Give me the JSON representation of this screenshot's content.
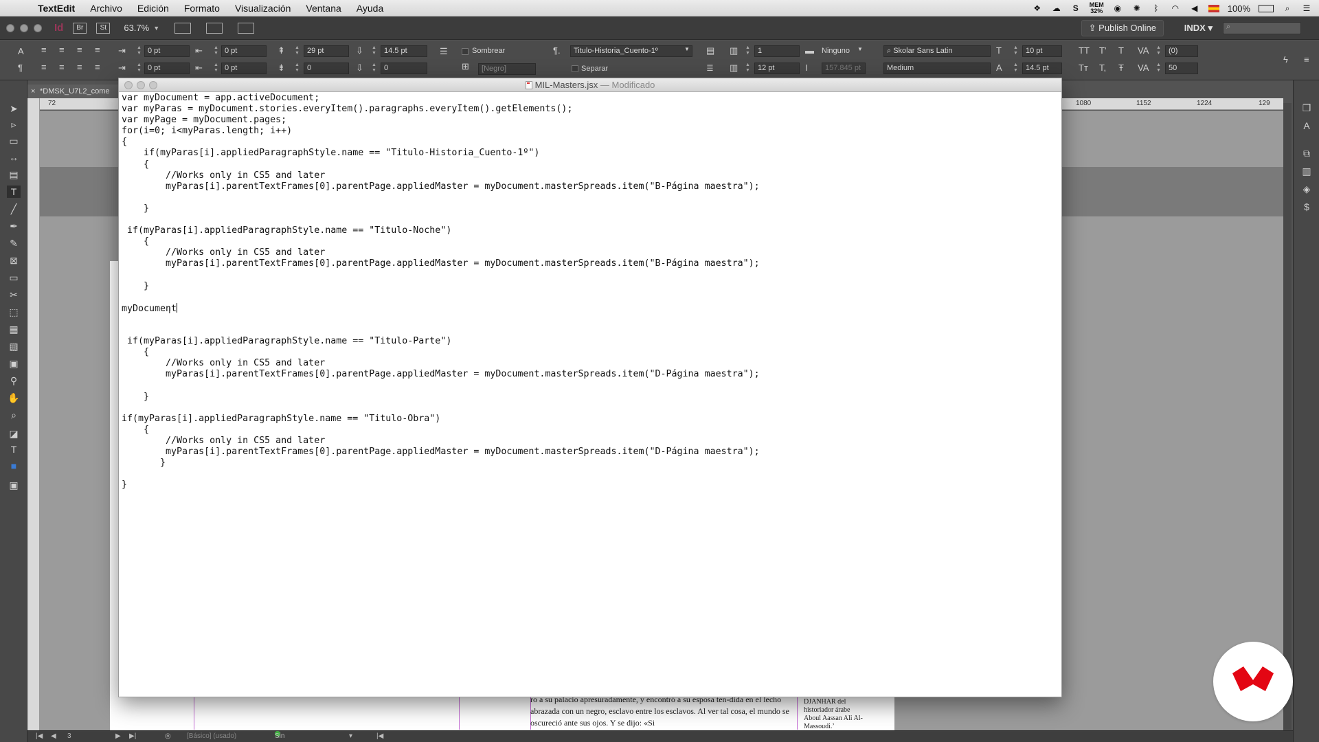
{
  "menubar": {
    "app_name": "TextEdit",
    "menus": [
      "Archivo",
      "Edición",
      "Formato",
      "Visualización",
      "Ventana",
      "Ayuda"
    ],
    "status": {
      "mem_label": "MEM",
      "mem_value": "32%",
      "battery": "100%",
      "icons": [
        "dropbox-icon",
        "cloud-icon",
        "s-icon",
        "mem-icon",
        "record-icon",
        "creative-cloud-icon",
        "bluetooth-icon",
        "wifi-icon",
        "volume-icon",
        "flag-icon",
        "battery-icon",
        "spotlight-icon",
        "notification-icon"
      ]
    }
  },
  "appbar": {
    "logo": "Id",
    "br_label": "Br",
    "st_label": "St",
    "zoom": "63.7%",
    "publish_label": "Publish Online",
    "workspace": "INDX"
  },
  "controlpanel": {
    "indent_left": "0 pt",
    "indent_first": "0 pt",
    "indent_right": "0 pt",
    "indent_last": "0 pt",
    "space_before": "29 pt",
    "space_after": "0",
    "leading_top": "14.5 pt",
    "leading_bottom": "0",
    "shade_label": "Sombrear",
    "shade_color": "[Negro]",
    "separate_label": "Separar",
    "paragraph_style": "Titulo-Historia_Cuento-1º",
    "columns": "1",
    "gutter": "12 pt",
    "span_label": "Ninguno",
    "span_value": "157.845 pt",
    "font_family": "Skolar Sans Latin",
    "font_style": "Medium",
    "font_size": "10 pt",
    "leading": "14.5 pt",
    "kerning": "(0)",
    "tracking": "50"
  },
  "document": {
    "tab_label": "*DMSK_U7L2_come",
    "ruler_marks": [
      "72",
      "1080",
      "1152",
      "1224",
      "129"
    ],
    "page_text": "ro a su palacio apresuradamente, y encontró a su esposa ten-dida en el lecho abrazada con un negro, esclavo entre los esclavos. Al ver tal cosa, el mundo se oscureció ante sus ojos. Y se dijo: «Si",
    "side_note": "DJANHAR del historiador árabe Aboul Aassan Ali Al-Massoudi.ʼ"
  },
  "statusbar": {
    "page": "3",
    "style": "[Básico] (usado)",
    "errors": "Sin errores"
  },
  "textedit": {
    "filename": "MIL-Masters.jsx",
    "separator": "—",
    "state": "Modificado",
    "lines": [
      "var myDocument = app.activeDocument;",
      "var myParas = myDocument.stories.everyItem().paragraphs.everyItem().getElements();",
      "var myPage = myDocument.pages;",
      "for(i=0; i<myParas.length; i++)",
      "{",
      "    if(myParas[i].appliedParagraphStyle.name == \"Titulo-Historia_Cuento-1º\")",
      "    {",
      "        //Works only in CS5 and later",
      "        myParas[i].parentTextFrames[0].parentPage.appliedMaster = myDocument.masterSpreads.item(\"B-Página maestra\");",
      "",
      "    }",
      "",
      " if(myParas[i].appliedParagraphStyle.name == \"Titulo-Noche\")",
      "    {",
      "        //Works only in CS5 and later",
      "        myParas[i].parentTextFrames[0].parentPage.appliedMaster = myDocument.masterSpreads.item(\"B-Página maestra\");",
      "",
      "    }",
      "",
      "myDocument",
      "",
      "",
      " if(myParas[i].appliedParagraphStyle.name == \"Titulo-Parte\")",
      "    {",
      "        //Works only in CS5 and later",
      "        myParas[i].parentTextFrames[0].parentPage.appliedMaster = myDocument.masterSpreads.item(\"D-Página maestra\");",
      "",
      "    }",
      "",
      "if(myParas[i].appliedParagraphStyle.name == \"Titulo-Obra\")",
      "    {",
      "        //Works only in CS5 and later",
      "        myParas[i].parentTextFrames[0].parentPage.appliedMaster = myDocument.masterSpreads.item(\"D-Página maestra\");",
      "       }",
      "",
      "}"
    ]
  },
  "colors": {
    "accent_red": "#e30613",
    "indesign_pink": "#d6336c",
    "margin_purple": "#c46bd4"
  }
}
